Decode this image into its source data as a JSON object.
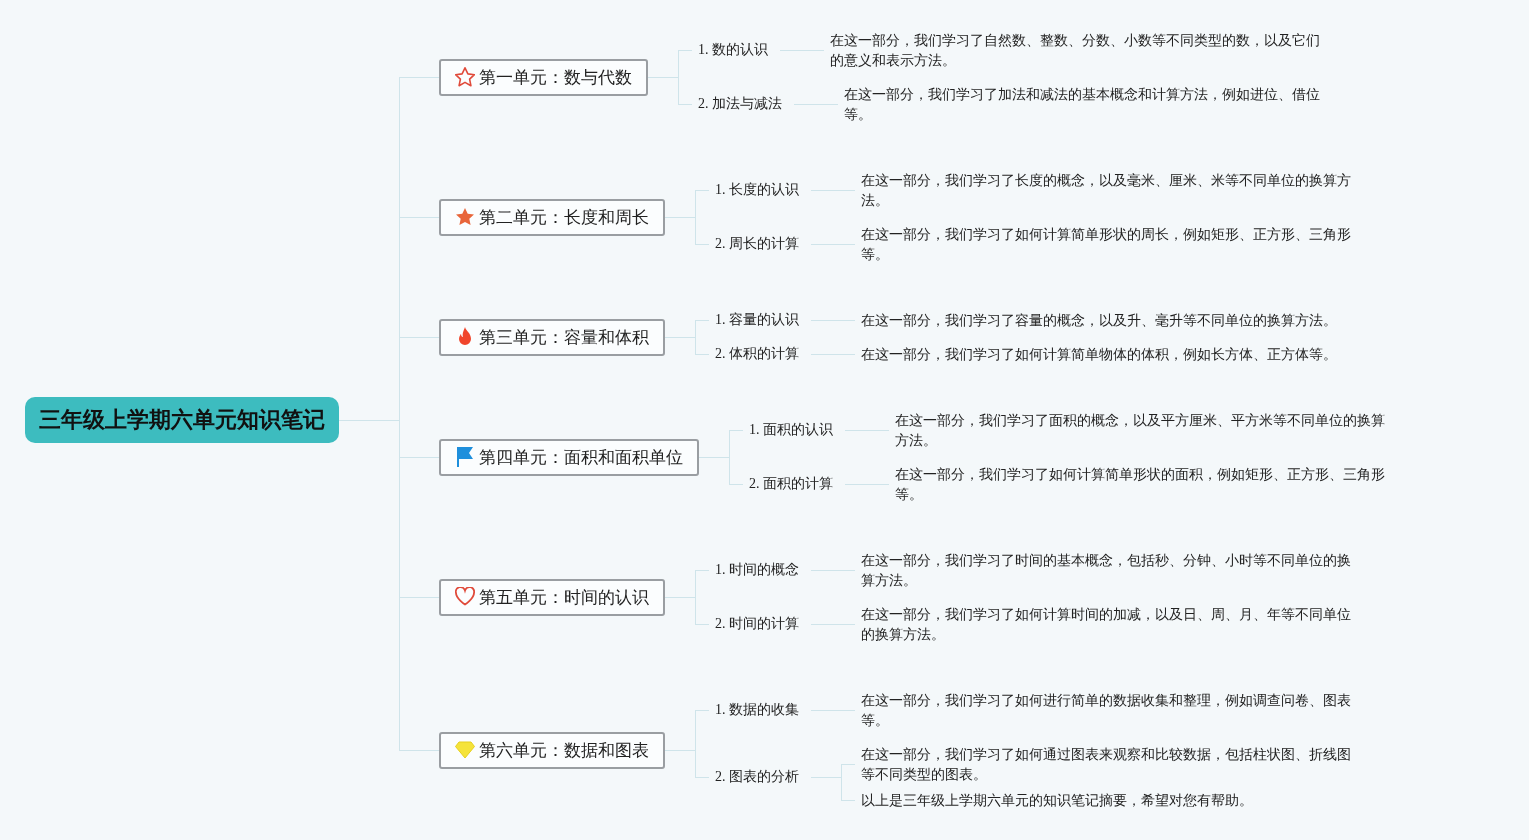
{
  "root": {
    "title": "三年级上学期六单元知识笔记"
  },
  "units": [
    {
      "title": "第一单元：数与代数",
      "kind": "star-outline",
      "topics": [
        {
          "label": "1. 数的认识",
          "notes": [
            "在这一部分，我们学习了自然数、整数、分数、小数等不同类型的数，以及它们的意义和表示方法。"
          ]
        },
        {
          "label": "2. 加法与减法",
          "notes": [
            "在这一部分，我们学习了加法和减法的基本概念和计算方法，例如进位、借位等。"
          ]
        }
      ]
    },
    {
      "title": "第二单元：长度和周长",
      "kind": "star",
      "topics": [
        {
          "label": "1. 长度的认识",
          "notes": [
            "在这一部分，我们学习了长度的概念，以及毫米、厘米、米等不同单位的换算方法。"
          ]
        },
        {
          "label": "2. 周长的计算",
          "notes": [
            "在这一部分，我们学习了如何计算简单形状的周长，例如矩形、正方形、三角形等。"
          ]
        }
      ]
    },
    {
      "title": "第三单元：容量和体积",
      "kind": "flame",
      "topics": [
        {
          "label": "1. 容量的认识",
          "notes": [
            "在这一部分，我们学习了容量的概念，以及升、毫升等不同单位的换算方法。"
          ]
        },
        {
          "label": "2. 体积的计算",
          "notes": [
            "在这一部分，我们学习了如何计算简单物体的体积，例如长方体、正方体等。"
          ]
        }
      ]
    },
    {
      "title": "第四单元：面积和面积单位",
      "kind": "flag",
      "topics": [
        {
          "label": "1. 面积的认识",
          "notes": [
            "在这一部分，我们学习了面积的概念，以及平方厘米、平方米等不同单位的换算方法。"
          ]
        },
        {
          "label": "2. 面积的计算",
          "notes": [
            "在这一部分，我们学习了如何计算简单形状的面积，例如矩形、正方形、三角形等。"
          ]
        }
      ]
    },
    {
      "title": "第五单元：时间的认识",
      "kind": "heart",
      "topics": [
        {
          "label": "1. 时间的概念",
          "notes": [
            "在这一部分，我们学习了时间的基本概念，包括秒、分钟、小时等不同单位的换算方法。"
          ]
        },
        {
          "label": "2. 时间的计算",
          "notes": [
            "在这一部分，我们学习了如何计算时间的加减，以及日、周、月、年等不同单位的换算方法。"
          ]
        }
      ]
    },
    {
      "title": "第六单元：数据和图表",
      "kind": "diamond",
      "topics": [
        {
          "label": "1. 数据的收集",
          "notes": [
            "在这一部分，我们学习了如何进行简单的数据收集和整理，例如调查问卷、图表等。"
          ]
        },
        {
          "label": "2. 图表的分析",
          "notes": [
            "在这一部分，我们学习了如何通过图表来观察和比较数据，包括柱状图、折线图等不同类型的图表。",
            "以上是三年级上学期六单元的知识笔记摘要，希望对您有帮助。"
          ]
        }
      ]
    }
  ]
}
